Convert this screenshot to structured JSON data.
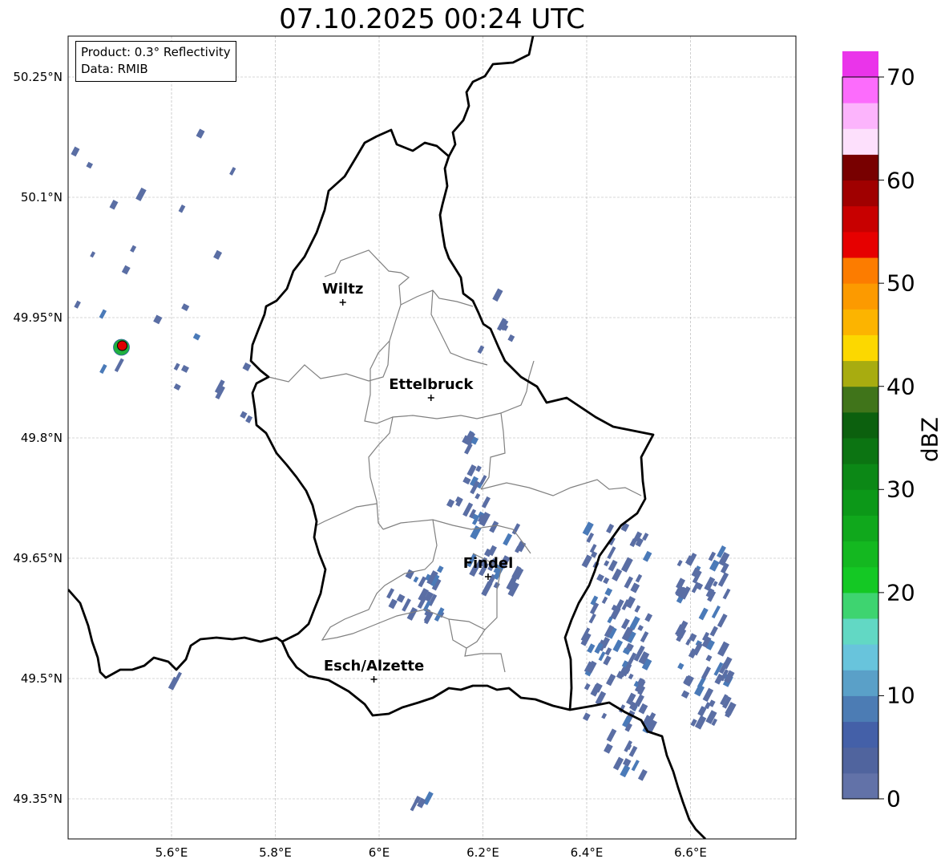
{
  "map": {
    "title": "07.10.2025 00:24 UTC",
    "info": {
      "product": "Product: 0.3° Reflectivity",
      "source": "Data: RMIB"
    },
    "extent": {
      "lon_min": 5.4,
      "lon_max": 6.8,
      "lat_min": 49.3,
      "lat_max": 50.3
    },
    "lat_ticks": [
      {
        "value": 50.25,
        "label": "50.25°N"
      },
      {
        "value": 50.1,
        "label": "50.1°N"
      },
      {
        "value": 49.95,
        "label": "49.95°N"
      },
      {
        "value": 49.8,
        "label": "49.8°N"
      },
      {
        "value": 49.65,
        "label": "49.65°N"
      },
      {
        "value": 49.5,
        "label": "49.5°N"
      },
      {
        "value": 49.35,
        "label": "49.35°N"
      }
    ],
    "lon_ticks": [
      {
        "value": 5.6,
        "label": "5.6°E"
      },
      {
        "value": 5.8,
        "label": "5.8°E"
      },
      {
        "value": 6.0,
        "label": "6°E"
      },
      {
        "value": 6.2,
        "label": "6.2°E"
      },
      {
        "value": 6.4,
        "label": "6.4°E"
      },
      {
        "value": 6.6,
        "label": "6.6°E"
      }
    ],
    "cities": [
      {
        "name": "Wiltz",
        "lon": 5.93,
        "lat": 49.969
      },
      {
        "name": "Ettelbruck",
        "lon": 6.1,
        "lat": 49.85
      },
      {
        "name": "Findel",
        "lon": 6.21,
        "lat": 49.627
      },
      {
        "name": "Esch/Alzette",
        "lon": 5.99,
        "lat": 49.499
      }
    ],
    "radar_site": {
      "lon": 5.505,
      "lat": 49.915
    },
    "colors": {
      "border": "#000000",
      "cantons": "#808080",
      "grid": "#b0b0b0",
      "site": "#e00000",
      "site_ring": "#20b040",
      "echo_weak": "#5a6ea4",
      "echo_mid": "#4a7ab8"
    }
  },
  "colorbar": {
    "label": "dBZ",
    "min": 0,
    "max": 70,
    "step": 2.5,
    "ticks": [
      0,
      10,
      20,
      30,
      40,
      50,
      60,
      70
    ],
    "colors": [
      "#6272a8",
      "#50649e",
      "#4460a8",
      "#4c7cb4",
      "#5aa0c8",
      "#68c4dc",
      "#62d8c4",
      "#3ed470",
      "#14c824",
      "#14b820",
      "#10a81c",
      "#0c9818",
      "#0c8816",
      "#0c7412",
      "#0c600e",
      "#40741a",
      "#a8ac10",
      "#fcd800",
      "#fcb400",
      "#fc9a00",
      "#fc7c00",
      "#e60000",
      "#c80000",
      "#a00000",
      "#780000",
      "#fde0fc",
      "#fcb4fc",
      "#fc6cfc",
      "#ea34ea"
    ]
  }
}
